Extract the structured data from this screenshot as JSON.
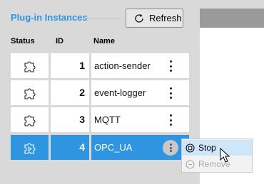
{
  "panel": {
    "title": "Plug-in Instances",
    "refresh_label": "Refresh"
  },
  "table": {
    "headers": [
      "Status",
      "ID",
      "Name"
    ],
    "rows": [
      {
        "id": "1",
        "name": "action-sender",
        "status_icon": "puzzle-icon"
      },
      {
        "id": "2",
        "name": "event-logger",
        "status_icon": "puzzle-icon"
      },
      {
        "id": "3",
        "name": "MQTT",
        "status_icon": "puzzle-icon"
      },
      {
        "id": "4",
        "name": "OPC_UA",
        "status_icon": "puzzle-running-icon"
      }
    ]
  },
  "context_menu": {
    "items": [
      {
        "label": "Stop",
        "icon": "stop-icon",
        "enabled": true
      },
      {
        "label": "Remove",
        "icon": "remove-icon",
        "enabled": false
      }
    ]
  },
  "colors": {
    "accent": "#2f95e0",
    "menu_hover": "#cfe6fa"
  }
}
